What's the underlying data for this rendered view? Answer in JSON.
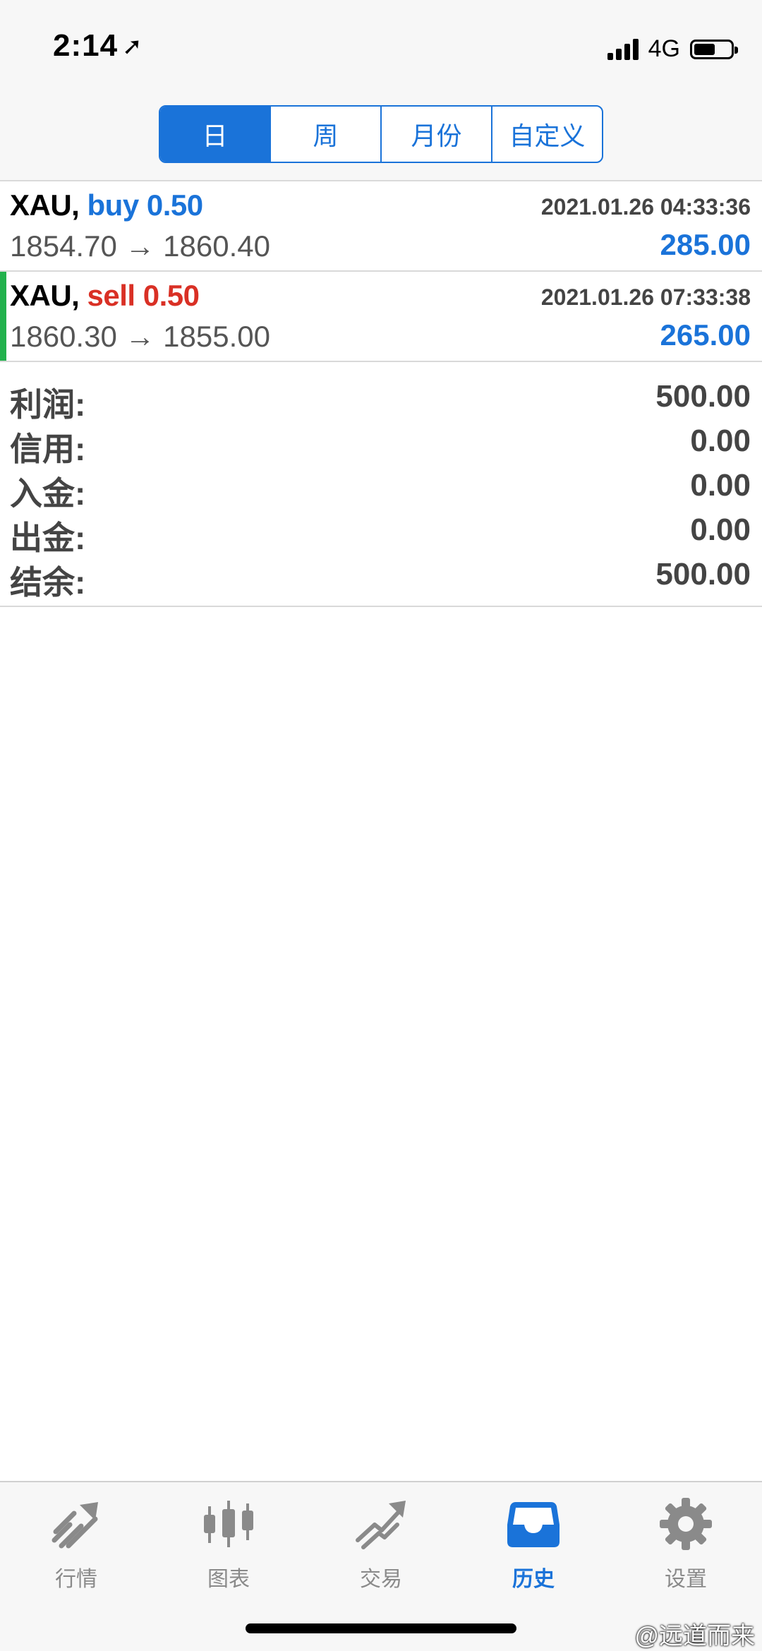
{
  "status": {
    "time": "2:14",
    "network": "4G",
    "battery_level": 0.62
  },
  "segments": [
    {
      "label": "日",
      "active": true
    },
    {
      "label": "周",
      "active": false
    },
    {
      "label": "月份",
      "active": false
    },
    {
      "label": "自定义",
      "active": false
    }
  ],
  "deals": [
    {
      "symbol": "XAU,",
      "side": "buy",
      "volume": "0.50",
      "time": "2021.01.26 04:33:36",
      "prices": "1854.70 → 1860.40",
      "profit": "285.00"
    },
    {
      "symbol": "XAU,",
      "side": "sell",
      "volume": "0.50",
      "time": "2021.01.26 07:33:38",
      "prices": "1860.30 → 1855.00",
      "profit": "265.00"
    }
  ],
  "summary": [
    {
      "label": "利润:",
      "value": "500.00"
    },
    {
      "label": "信用:",
      "value": "0.00"
    },
    {
      "label": "入金:",
      "value": "0.00"
    },
    {
      "label": "出金:",
      "value": "0.00"
    },
    {
      "label": "结余:",
      "value": "500.00"
    }
  ],
  "tabs": [
    {
      "label": "行情",
      "icon": "quotes-arrow-icon",
      "active": false
    },
    {
      "label": "图表",
      "icon": "candlestick-chart-icon",
      "active": false
    },
    {
      "label": "交易",
      "icon": "trade-trend-icon",
      "active": false
    },
    {
      "label": "历史",
      "icon": "history-inbox-icon",
      "active": true
    },
    {
      "label": "设置",
      "icon": "gear-icon",
      "active": false
    }
  ],
  "watermark": "@远道而来",
  "colors": {
    "accent": "#1a73d9",
    "sell": "#d93025",
    "marker": "#22b14c",
    "inactive_icon": "#8a8a8a"
  }
}
